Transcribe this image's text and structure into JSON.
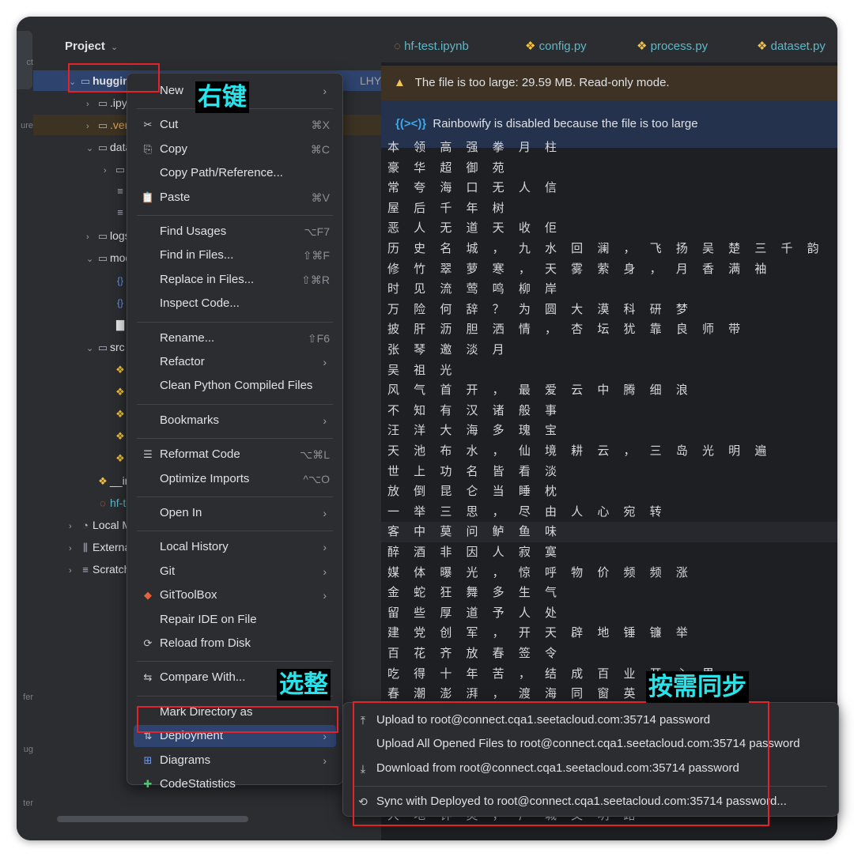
{
  "left_strip": {
    "labels": [
      "ct",
      "ure",
      "fer",
      "ug",
      "ter"
    ]
  },
  "project_panel": {
    "title": "Project",
    "title_chevron": "chevron-down",
    "tree": [
      {
        "label": "huggin",
        "icon": "folder",
        "chevron": "v",
        "bold": true
      },
      {
        "label": ".ipyr",
        "icon": "folder",
        "chevron": ">"
      },
      {
        "label": ".ven",
        "icon": "folder",
        "chevron": ">",
        "highlight": "venv"
      },
      {
        "label": "data",
        "icon": "folder",
        "chevron": "v"
      },
      {
        "label": "p",
        "icon": "folder",
        "chevron": ">"
      },
      {
        "label": "i",
        "icon": "text-file"
      },
      {
        "label": "c",
        "icon": "text-file"
      },
      {
        "label": "logs",
        "icon": "folder",
        "chevron": ">"
      },
      {
        "label": "mod",
        "icon": "folder",
        "chevron": "v"
      },
      {
        "label": "c",
        "icon": "json"
      },
      {
        "label": "g",
        "icon": "json"
      },
      {
        "label": "n",
        "icon": "file"
      },
      {
        "label": "src",
        "icon": "folder",
        "chevron": "v"
      },
      {
        "label": "c",
        "icon": "python"
      },
      {
        "label": "d",
        "icon": "python"
      },
      {
        "label": "p",
        "icon": "python"
      },
      {
        "label": "p",
        "icon": "python"
      },
      {
        "label": "t",
        "icon": "python"
      },
      {
        "label": "__in",
        "icon": "python"
      },
      {
        "label": "hf-te",
        "icon": "notebook"
      },
      {
        "label": "Local M",
        "icon": "local",
        "chevron": ">"
      },
      {
        "label": "Externa",
        "icon": "library",
        "chevron": ">"
      },
      {
        "label": "Scratch",
        "icon": "scratch",
        "chevron": ">"
      }
    ],
    "root_suffix": "LHYYH"
  },
  "tabs": [
    {
      "label": "hf-test.ipynb",
      "icon": "notebook"
    },
    {
      "label": "config.py",
      "icon": "python"
    },
    {
      "label": "process.py",
      "icon": "python"
    },
    {
      "label": "dataset.py",
      "icon": "python"
    }
  ],
  "banners": {
    "warning": "The file is too large: 29.59 MB. Read-only mode.",
    "rainbow_icon": "{(><)}",
    "rainbow": "Rainbowify is disabled because the file is too large"
  },
  "code_lines": [
    "本 领 高 强 拳 月 柱",
    "豪 华 超 御 苑",
    "常 夸 海 口 无 人 信",
    "屋 后 千 年 树",
    "恶 人 无 道 天 收 佢",
    "历 史 名 城 ， 九 水 回 澜 ， 飞 扬 吴 楚 三 千 韵",
    "修 竹 翠 萝 寒 ， 天 雾 萦 身 ， 月 香 满 袖",
    "时 见 流 莺 鸣 柳 岸",
    "万 险 何 辞 ？ 为 圆 大 漠 科 研 梦",
    "披 肝 沥 胆 洒 情 ， 杏 坛 犹 靠 良 师 带",
    "张 琴 邀 淡 月",
    "吴 祖 光",
    "风 气 首 开 ， 最 爱 云 中 腾 细 浪",
    "不 知 有 汉 诸 般 事",
    "汪 洋 大 海 多 瑰 宝",
    "天 池 布 水 ， 仙 境 耕 云 ， 三 岛 光 明 遍",
    "世 上 功 名 皆 看 淡",
    "放 倒 昆 仑 当 睡 枕",
    "一 举 三 思 ， 尽 由 人 心 宛 转",
    "客 中 莫 问 鲈 鱼 味",
    "醉 酒 非 因 人 寂 寞",
    "媒 体 曝 光 ， 惊 呼 物 价 频 频 涨",
    "金 蛇 狂 舞 多 生 气",
    "留 些 厚 道 予 人 处",
    "建 党 创 军 ， 开 天 辟 地 锤 镰 举",
    "百 花 齐 放 春 签 令",
    "吃 得 十 年 苦 ， 结 成 百 业 开 心 果",
    "春 潮 澎 湃 ， 渡 海 同 窗 英 吉 利",
    "",
    "",
    "",
    "",
    "",
    "大 地 钟 灵 ， 广 城 文 明 路"
  ],
  "context_menu": {
    "items": [
      {
        "label": "New",
        "arrow": true
      },
      {
        "sep": true
      },
      {
        "label": "Cut",
        "icon": "✂",
        "shortcut": "⌘X"
      },
      {
        "label": "Copy",
        "icon": "⎘",
        "shortcut": "⌘C"
      },
      {
        "label": "Copy Path/Reference..."
      },
      {
        "label": "Paste",
        "icon": "📋",
        "shortcut": "⌘V"
      },
      {
        "sep": true
      },
      {
        "label": "Find Usages",
        "shortcut": "⌥F7"
      },
      {
        "label": "Find in Files...",
        "shortcut": "⇧⌘F"
      },
      {
        "label": "Replace in Files...",
        "shortcut": "⇧⌘R"
      },
      {
        "label": "Inspect Code..."
      },
      {
        "sep": true
      },
      {
        "label": "Rename...",
        "shortcut": "⇧F6"
      },
      {
        "label": "Refactor",
        "arrow": true
      },
      {
        "label": "Clean Python Compiled Files"
      },
      {
        "sep": true
      },
      {
        "label": "Bookmarks",
        "arrow": true
      },
      {
        "sep": true
      },
      {
        "label": "Reformat Code",
        "icon": "☰",
        "shortcut": "⌥⌘L"
      },
      {
        "label": "Optimize Imports",
        "shortcut": "^⌥O"
      },
      {
        "sep": true
      },
      {
        "label": "Open In",
        "arrow": true
      },
      {
        "sep": true
      },
      {
        "label": "Local History",
        "arrow": true
      },
      {
        "label": "Git",
        "arrow": true
      },
      {
        "label": "GitToolBox",
        "icon": "◆",
        "arrow": true
      },
      {
        "label": "Repair IDE on File"
      },
      {
        "label": "Reload from Disk",
        "icon": "⟳"
      },
      {
        "sep": true
      },
      {
        "label": "Compare With...",
        "icon": "⇆",
        "shortcut": "⌘D"
      },
      {
        "sep": true
      },
      {
        "label": "Mark Directory as"
      },
      {
        "label": "Deployment",
        "icon": "⇅",
        "arrow": true,
        "active": true
      },
      {
        "label": "Diagrams",
        "icon": "⊞",
        "arrow": true
      },
      {
        "label": "CodeStatistics",
        "icon": "✚"
      }
    ]
  },
  "submenu": {
    "items": [
      {
        "label": "Upload to root@connect.cqa1.seetacloud.com:35714 password",
        "icon": "⤒"
      },
      {
        "label": "Upload All Opened Files to root@connect.cqa1.seetacloud.com:35714 password"
      },
      {
        "label": "Download from root@connect.cqa1.seetacloud.com:35714 password",
        "icon": "⤓"
      },
      {
        "sep": true
      },
      {
        "label": "Sync with Deployed to root@connect.cqa1.seetacloud.com:35714 password...",
        "icon": "⟲"
      }
    ]
  },
  "annotations": {
    "right_click": "右键",
    "select_whole": "选整",
    "sync_as_needed": "按需同步"
  },
  "colors": {
    "annotation_text": "#29e3ea",
    "annotation_box": "#e0242a",
    "selection": "#2e436e"
  }
}
